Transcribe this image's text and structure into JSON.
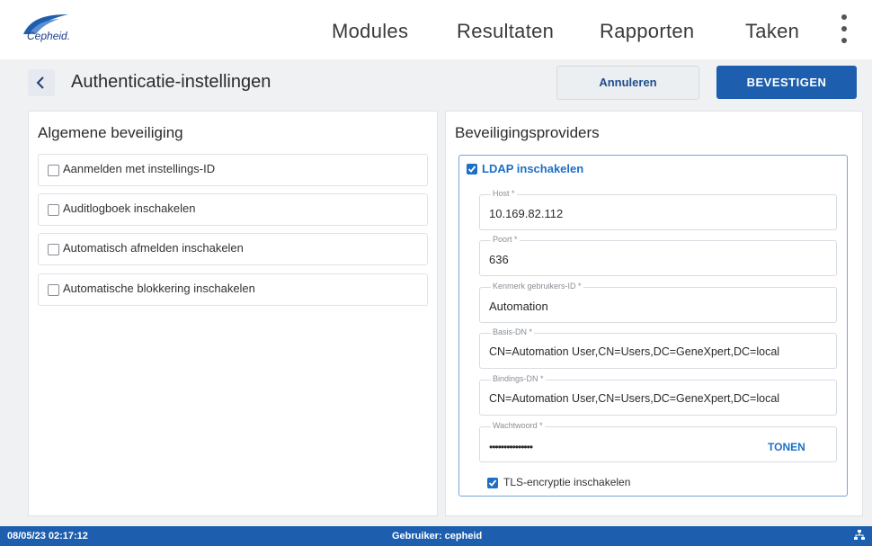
{
  "brand": {
    "logo_text": "Cepheid."
  },
  "nav": {
    "items": [
      "Modules",
      "Resultaten",
      "Rapporten",
      "Taken"
    ]
  },
  "page": {
    "title": "Authenticatie-instellingen",
    "cancel_label": "Annuleren",
    "confirm_label": "BEVESTIGEN"
  },
  "general": {
    "heading": "Algemene beveiliging",
    "options": [
      {
        "label": "Aanmelden met instellings-ID",
        "checked": false
      },
      {
        "label": "Auditlogboek inschakelen",
        "checked": false
      },
      {
        "label": "Automatisch afmelden inschakelen",
        "checked": false
      },
      {
        "label": "Automatische blokkering inschakelen",
        "checked": false
      }
    ]
  },
  "providers": {
    "heading": "Beveiligingsproviders",
    "ldap_label": "LDAP inschakelen",
    "ldap_checked": true,
    "fields": {
      "host": {
        "label": "Host *",
        "value": "10.169.82.112"
      },
      "port": {
        "label": "Poort *",
        "value": "636"
      },
      "user_id_attr": {
        "label": "Kenmerk gebruikers-ID *",
        "value": "Automation"
      },
      "base_dn": {
        "label": "Basis-DN *",
        "value": "CN=Automation User,CN=Users,DC=GeneXpert,DC=local"
      },
      "bind_dn": {
        "label": "Bindings-DN *",
        "value": "CN=Automation User,CN=Users,DC=GeneXpert,DC=local"
      },
      "password": {
        "label": "Wachtwoord *",
        "value": "•••••••••••••••",
        "show_label": "TONEN"
      }
    },
    "tls_label": "TLS-encryptie inschakelen",
    "tls_checked": true
  },
  "status": {
    "datetime": "08/05/23 02:17:12",
    "user": "Gebruiker: cepheid"
  },
  "colors": {
    "primary": "#1d5fae",
    "accent": "#1d6fc7",
    "background": "#f0f1f3"
  }
}
